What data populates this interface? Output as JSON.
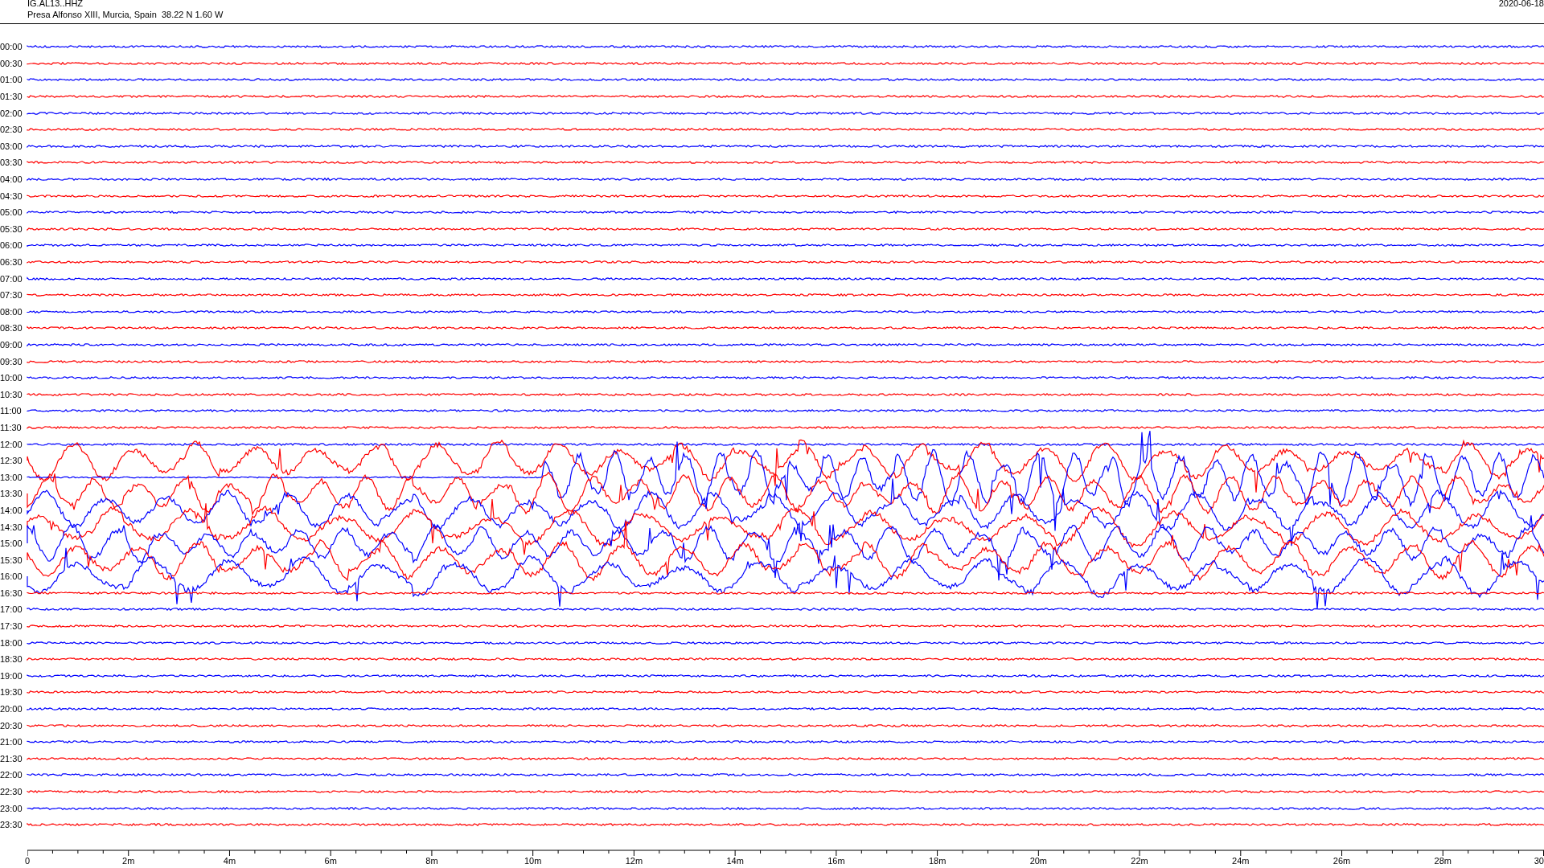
{
  "header": {
    "station": "IG.AL13..HHZ",
    "location": "Presa Alfonso XIII, Murcia, Spain  38.22 N 1.60 W",
    "date": "2020-06-18"
  },
  "rows": [
    {
      "time": "00:00",
      "color": "#0000ff",
      "kind": "quiet"
    },
    {
      "time": "00:30",
      "color": "#ff0000",
      "kind": "quiet"
    },
    {
      "time": "01:00",
      "color": "#0000ff",
      "kind": "quiet"
    },
    {
      "time": "01:30",
      "color": "#ff0000",
      "kind": "quiet"
    },
    {
      "time": "02:00",
      "color": "#0000ff",
      "kind": "quiet"
    },
    {
      "time": "02:30",
      "color": "#ff0000",
      "kind": "quiet"
    },
    {
      "time": "03:00",
      "color": "#0000ff",
      "kind": "quiet"
    },
    {
      "time": "03:30",
      "color": "#ff0000",
      "kind": "quiet"
    },
    {
      "time": "04:00",
      "color": "#0000ff",
      "kind": "quiet"
    },
    {
      "time": "04:30",
      "color": "#ff0000",
      "kind": "quiet"
    },
    {
      "time": "05:00",
      "color": "#0000ff",
      "kind": "quiet"
    },
    {
      "time": "05:30",
      "color": "#ff0000",
      "kind": "quiet"
    },
    {
      "time": "06:00",
      "color": "#0000ff",
      "kind": "quiet"
    },
    {
      "time": "06:30",
      "color": "#ff0000",
      "kind": "quiet"
    },
    {
      "time": "07:00",
      "color": "#0000ff",
      "kind": "quiet"
    },
    {
      "time": "07:30",
      "color": "#ff0000",
      "kind": "quiet"
    },
    {
      "time": "08:00",
      "color": "#0000ff",
      "kind": "quiet"
    },
    {
      "time": "08:30",
      "color": "#ff0000",
      "kind": "quiet"
    },
    {
      "time": "09:00",
      "color": "#0000ff",
      "kind": "quiet"
    },
    {
      "time": "09:30",
      "color": "#ff0000",
      "kind": "quiet"
    },
    {
      "time": "10:00",
      "color": "#0000ff",
      "kind": "quiet"
    },
    {
      "time": "10:30",
      "color": "#ff0000",
      "kind": "quiet"
    },
    {
      "time": "11:00",
      "color": "#0000ff",
      "kind": "quiet"
    },
    {
      "time": "11:30",
      "color": "#ff0000",
      "kind": "quiet"
    },
    {
      "time": "12:00",
      "color": "#0000ff",
      "kind": "quiet"
    },
    {
      "time": "12:30",
      "color": "#ff0000",
      "kind": "active"
    },
    {
      "time": "13:00",
      "color": "#0000ff",
      "kind": "late"
    },
    {
      "time": "13:30",
      "color": "#ff0000",
      "kind": "active"
    },
    {
      "time": "14:00",
      "color": "#0000ff",
      "kind": "active"
    },
    {
      "time": "14:30",
      "color": "#ff0000",
      "kind": "active"
    },
    {
      "time": "15:00",
      "color": "#0000ff",
      "kind": "active"
    },
    {
      "time": "15:30",
      "color": "#ff0000",
      "kind": "active"
    },
    {
      "time": "16:00",
      "color": "#0000ff",
      "kind": "active"
    },
    {
      "time": "16:30",
      "color": "#ff0000",
      "kind": "quiet"
    },
    {
      "time": "17:00",
      "color": "#0000ff",
      "kind": "quiet"
    },
    {
      "time": "17:30",
      "color": "#ff0000",
      "kind": "quiet"
    },
    {
      "time": "18:00",
      "color": "#0000ff",
      "kind": "quiet"
    },
    {
      "time": "18:30",
      "color": "#ff0000",
      "kind": "quiet"
    },
    {
      "time": "19:00",
      "color": "#0000ff",
      "kind": "quiet"
    },
    {
      "time": "19:30",
      "color": "#ff0000",
      "kind": "quiet"
    },
    {
      "time": "20:00",
      "color": "#0000ff",
      "kind": "quiet"
    },
    {
      "time": "20:30",
      "color": "#ff0000",
      "kind": "quiet"
    },
    {
      "time": "21:00",
      "color": "#0000ff",
      "kind": "quiet"
    },
    {
      "time": "21:30",
      "color": "#ff0000",
      "kind": "quiet"
    },
    {
      "time": "22:00",
      "color": "#0000ff",
      "kind": "quiet"
    },
    {
      "time": "22:30",
      "color": "#ff0000",
      "kind": "quiet"
    },
    {
      "time": "23:00",
      "color": "#0000ff",
      "kind": "quiet"
    },
    {
      "time": "23:30",
      "color": "#ff0000",
      "kind": "quiet"
    }
  ],
  "x_axis": {
    "labels": [
      "0",
      "2m",
      "4m",
      "6m",
      "8m",
      "10m",
      "12m",
      "14m",
      "16m",
      "18m",
      "20m",
      "22m",
      "24m",
      "26m",
      "28m",
      "30"
    ]
  }
}
